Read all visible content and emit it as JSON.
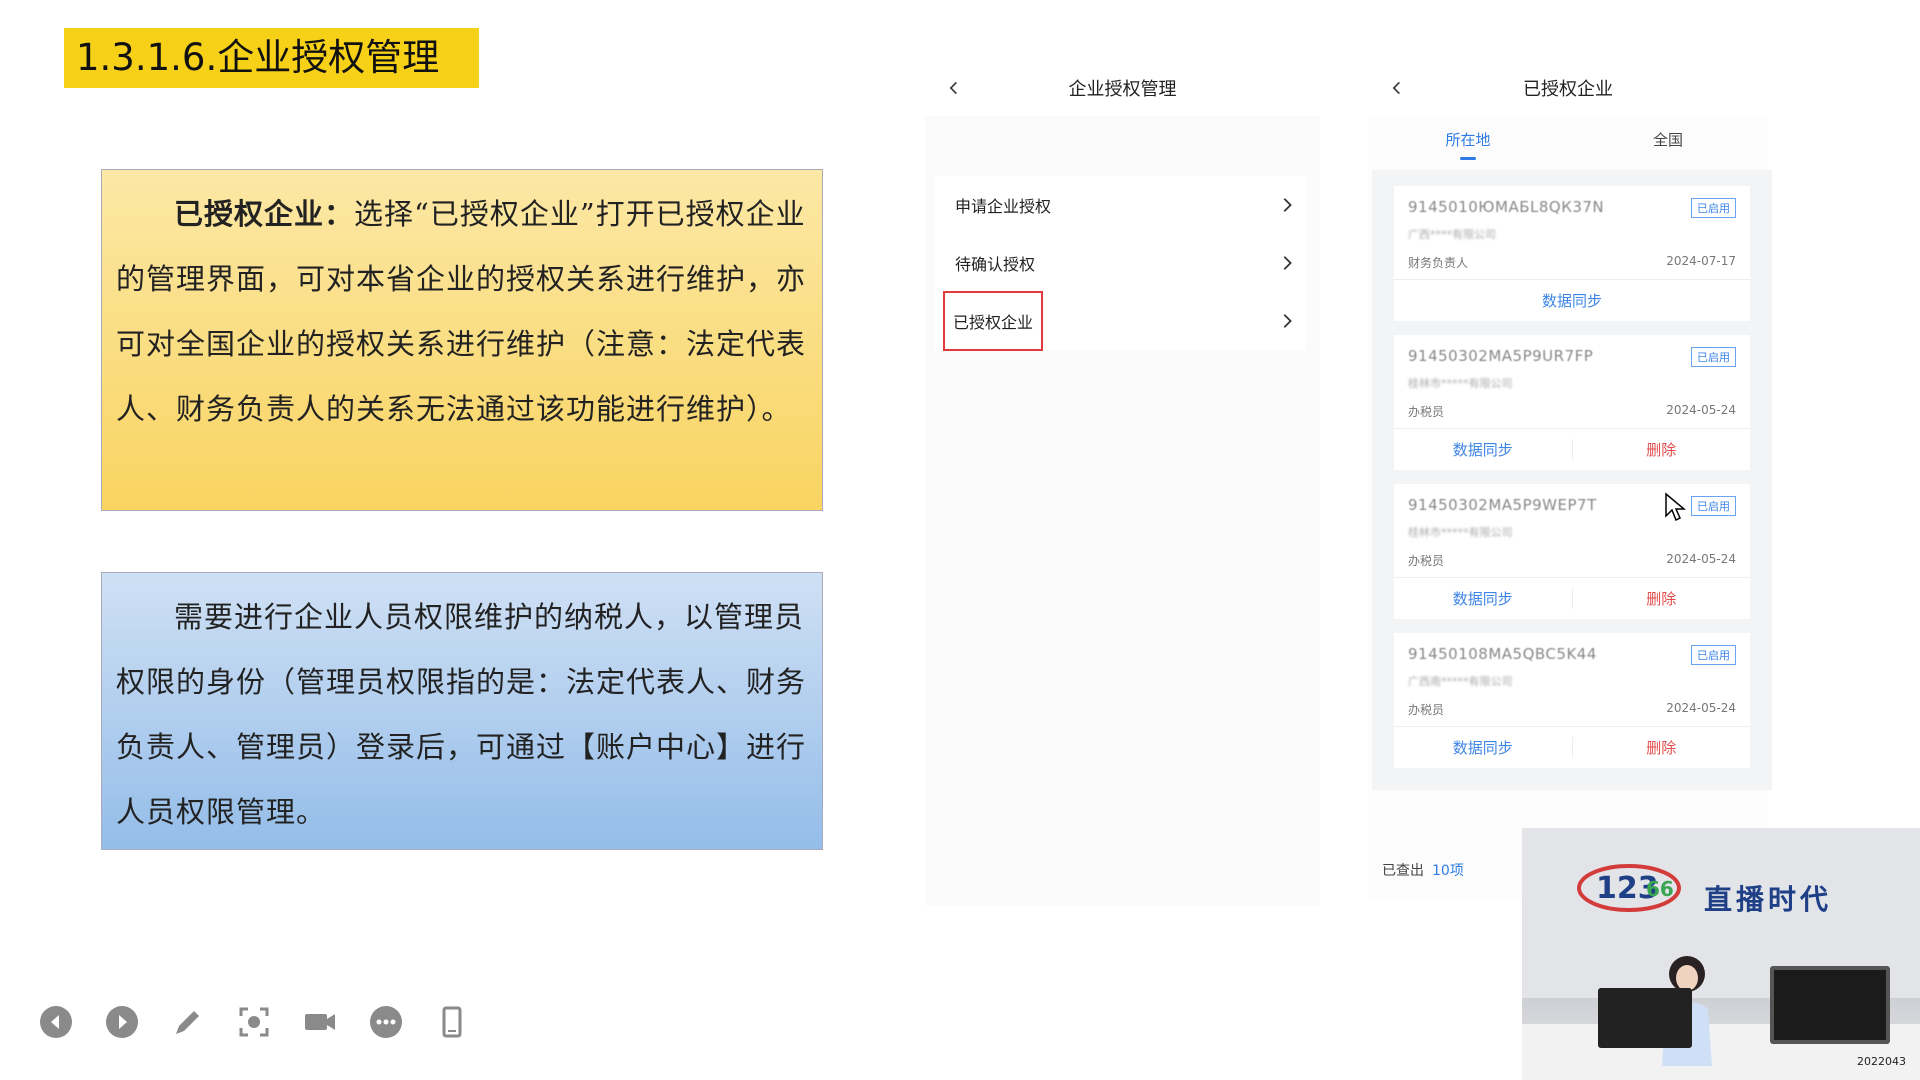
{
  "slide": {
    "title": "1.3.1.6.企业授权管理"
  },
  "box_yellow": {
    "bold_lead": "已授权企业：",
    "text": "选择“已授权企业”打开已授权企业的管理界面，可对本省企业的授权关系进行维护，亦可对全国企业的授权关系进行维护（注意：法定代表人、财务负责人的关系无法通过该功能进行维护）。"
  },
  "box_blue": {
    "text": "需要进行企业人员权限维护的纳税人，以管理员权限的身份（管理员权限指的是：法定代表人、财务负责人、管理员）登录后，可通过【账户中心】进行人员权限管理。"
  },
  "controls": [
    "prev-icon",
    "next-icon",
    "pen-icon",
    "screenshot-icon",
    "camera-icon",
    "more-icon",
    "phone-icon"
  ],
  "phone1": {
    "title": "企业授权管理",
    "menu": [
      {
        "label": "申请企业授权"
      },
      {
        "label": "待确认授权"
      },
      {
        "label": "已授权企业"
      }
    ]
  },
  "phone2": {
    "title": "已授权企业",
    "tabs": [
      "所在地",
      "全国"
    ],
    "cards": [
      {
        "code": "9145010ЮМАБL8QК37N",
        "subname": "广西****有限公司",
        "badge": "已启用",
        "role": "财务负责人",
        "date": "2024-07-17",
        "actions": [
          "数据同步"
        ]
      },
      {
        "code": "91450302MA5P9UR7FP",
        "subname": "桂林市*****有限公司",
        "badge": "已启用",
        "role": "办税员",
        "date": "2024-05-24",
        "actions": [
          "数据同步",
          "删除"
        ]
      },
      {
        "code": "91450302MA5P9WEP7T",
        "subname": "桂林市*****有限公司",
        "badge": "已启用",
        "role": "办税员",
        "date": "2024-05-24",
        "actions": [
          "数据同步",
          "删除"
        ]
      },
      {
        "code": "91450108MA5QBC5K44",
        "subname": "广西南*****有限公司",
        "badge": "已启用",
        "role": "办税员",
        "date": "2024-05-24",
        "actions": [
          "数据同步",
          "删除"
        ]
      }
    ],
    "footer_label": "已查出",
    "footer_count": "10项"
  },
  "webcam": {
    "logo_text": "直播时代",
    "stamp": "2022043"
  },
  "colors": {
    "title_bg": "#f7d117",
    "accent_blue": "#2e7be6",
    "delete_red": "#e24c4c",
    "highlight_red": "#e03a3a"
  }
}
